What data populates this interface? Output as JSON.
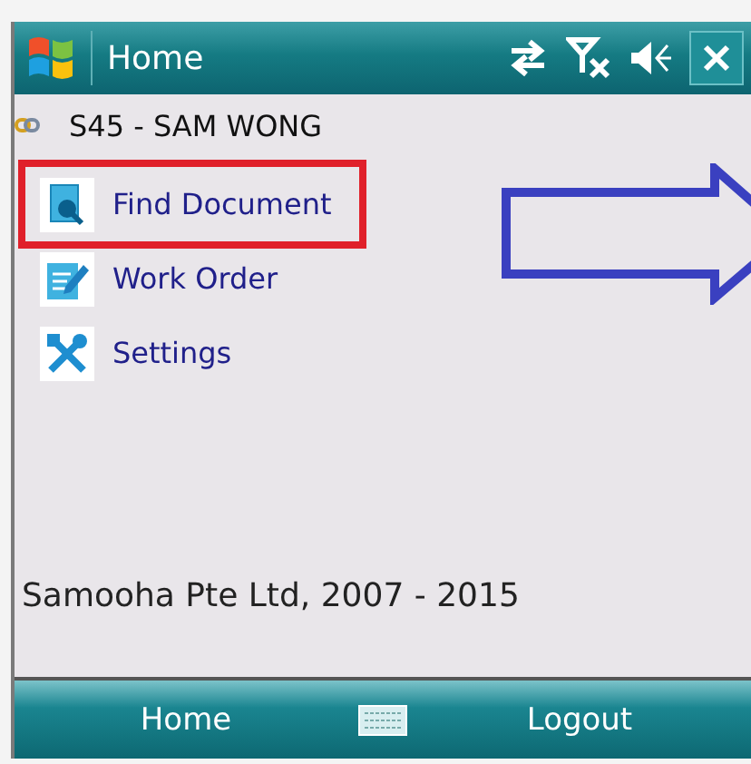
{
  "window": {
    "title": "Home"
  },
  "user": "S45 - SAM WONG",
  "menu": [
    {
      "label": "Find Document",
      "kind": "find",
      "highlighted": true
    },
    {
      "label": "Work Order",
      "kind": "order",
      "highlighted": false
    },
    {
      "label": "Settings",
      "kind": "settings",
      "highlighted": false
    }
  ],
  "footer": "Samooha Pte Ltd, 2007 - 2015",
  "softkeys": [
    "Home",
    "Logout"
  ]
}
